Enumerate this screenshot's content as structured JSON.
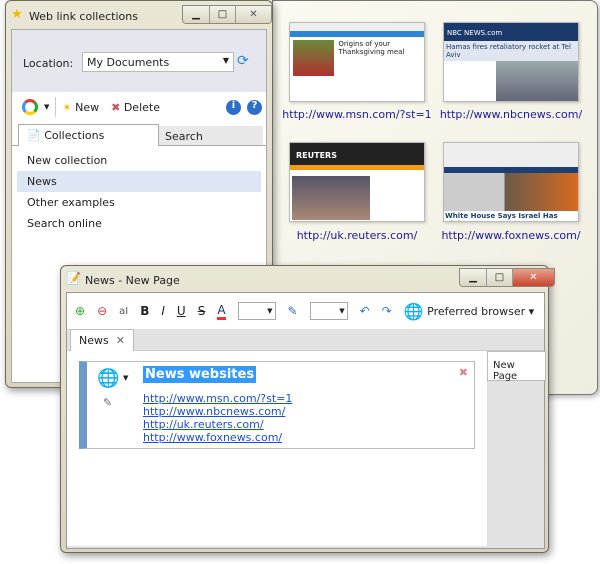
{
  "main_window": {
    "title": "Web link collections",
    "location_label": "Location:",
    "location_value": "My Documents",
    "new_label": "New",
    "delete_label": "Delete",
    "tabs": [
      "Collections",
      "Search"
    ],
    "items": [
      "New collection",
      "News",
      "Other examples",
      "Search online"
    ],
    "selected_index": 1
  },
  "thumbnails": [
    {
      "url": "http://www.msn.com/?st=1",
      "headline": "Origins of your Thanksgiving meal",
      "bg": "#2e86d6"
    },
    {
      "url": "http://www.nbcnews.com/",
      "headline": "Hamas fires retaliatory rocket at Tel Aviv",
      "bg": "#1b3a6b"
    },
    {
      "url": "http://uk.reuters.com/",
      "headline": "REUTERS",
      "bg": "#222"
    },
    {
      "url": "http://www.foxnews.com/",
      "headline": "White House Says Israel Has Right",
      "bg": "#1d3f73"
    }
  ],
  "news_window": {
    "title": "News - New Page",
    "preferred_browser": "Preferred browser",
    "tab": "News",
    "page_tab": "New Page",
    "note_title": "News websites",
    "links": [
      "http://www.msn.com/?st=1",
      "http://www.nbcnews.com/",
      "http://uk.reuters.com/",
      "http://www.foxnews.com/"
    ],
    "format": {
      "bold": "B",
      "italic": "I",
      "underline": "U",
      "strike": "S",
      "font_color": "A"
    }
  },
  "colors": {
    "accent": "#3399ff",
    "link": "#1a4fd6",
    "selection": "#dce6f5"
  }
}
